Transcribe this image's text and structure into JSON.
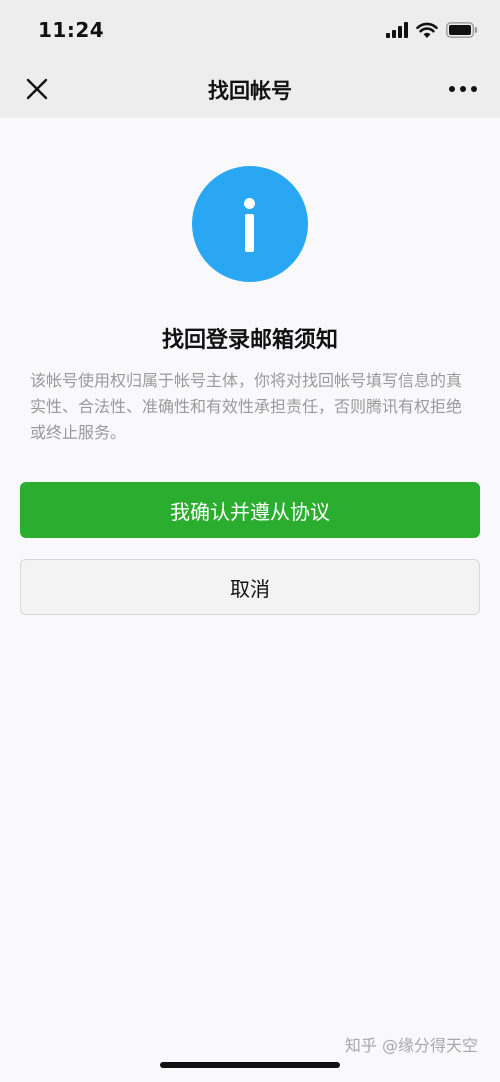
{
  "status_bar": {
    "time": "11:24",
    "icons": [
      "signal-icon",
      "wifi-icon",
      "battery-icon"
    ]
  },
  "nav": {
    "title": "找回帐号",
    "left_icon": "close-icon",
    "right_icon": "more-icon"
  },
  "notice": {
    "icon": "info-icon",
    "icon_color": "#2aa7f3",
    "title": "找回登录邮箱须知",
    "description": "该帐号使用权归属于帐号主体，你将对找回帐号填写信息的真实性、合法性、准确性和有效性承担责任，否则腾讯有权拒绝或终止服务。"
  },
  "buttons": {
    "confirm_label": "我确认并遵从协议",
    "confirm_color": "#2bad2f",
    "cancel_label": "取消"
  },
  "watermark": {
    "text": "知乎 @缘分得天空"
  }
}
